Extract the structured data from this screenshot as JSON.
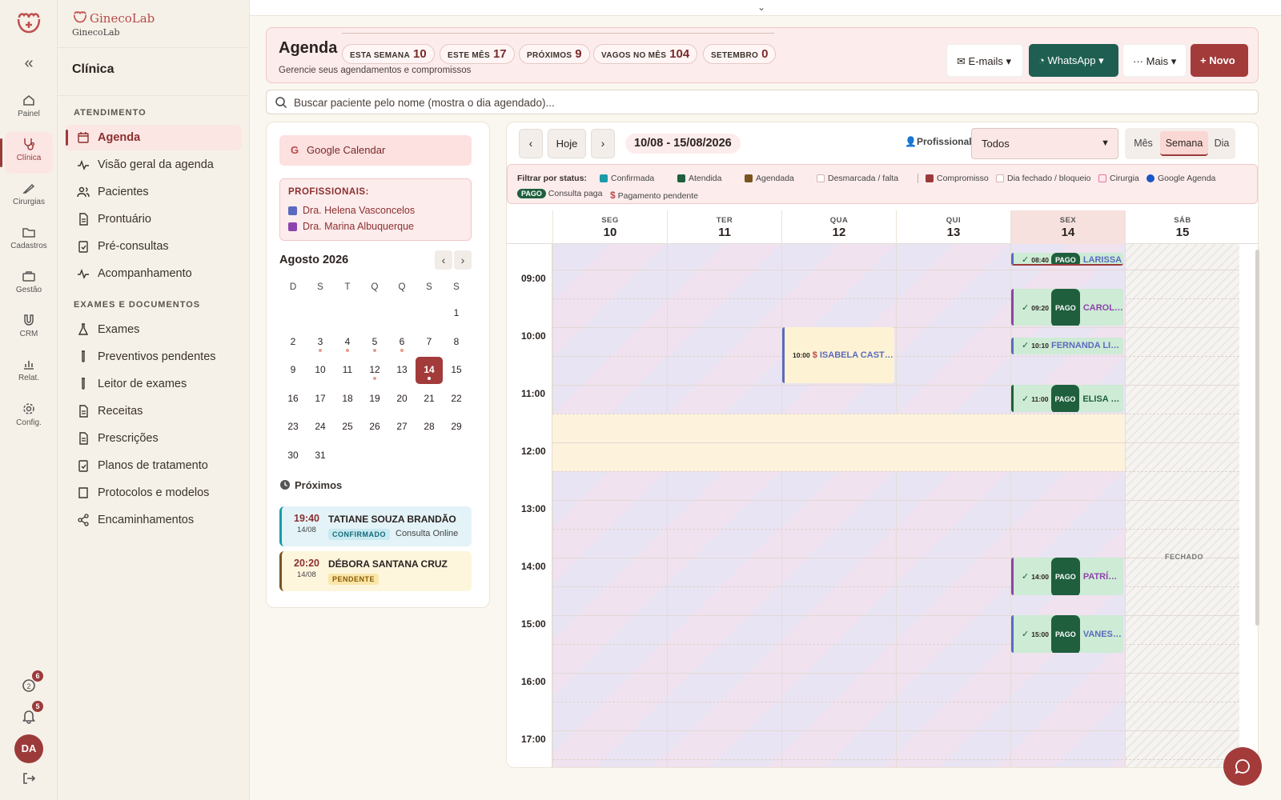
{
  "app": {
    "brand_name": "GinecoLab",
    "brand_sub": "GinecoLab"
  },
  "rail": {
    "items": [
      {
        "label": "Painel",
        "icon": "home-icon"
      },
      {
        "label": "Clínica",
        "icon": "stethoscope-icon",
        "active": true
      },
      {
        "label": "Cirurgias",
        "icon": "scalpel-icon"
      },
      {
        "label": "Cadastros",
        "icon": "folder-icon"
      },
      {
        "label": "Gestão",
        "icon": "briefcase-icon"
      },
      {
        "label": "CRM",
        "icon": "magnet-icon"
      },
      {
        "label": "Relat.",
        "icon": "bar-chart-icon"
      },
      {
        "label": "Config.",
        "icon": "gear-icon"
      }
    ],
    "help_badge": "6",
    "notif_badge": "5",
    "avatar_initials": "DA"
  },
  "sidebar": {
    "title": "Clínica",
    "section1": "ATENDIMENTO",
    "section1_items": [
      "Agenda",
      "Visão geral da agenda",
      "Pacientes",
      "Prontuário",
      "Pré-consultas",
      "Acompanhamento"
    ],
    "section2": "EXAMES E DOCUMENTOS",
    "section2_items": [
      "Exames",
      "Preventivos pendentes",
      "Leitor de exames",
      "Receitas",
      "Prescrições",
      "Planos de tratamento",
      "Protocolos e modelos",
      "Encaminhamentos"
    ]
  },
  "header": {
    "title": "Agenda",
    "subtitle": "Gerencie seus agendamentos e compromissos",
    "stats": [
      {
        "label": "ESTA SEMANA",
        "value": "10"
      },
      {
        "label": "ESTE MÊS",
        "value": "17"
      },
      {
        "label": "PRÓXIMOS",
        "value": "9"
      },
      {
        "label": "VAGOS NO MÊS",
        "value": "104"
      },
      {
        "label": "SETEMBRO",
        "value": "0"
      }
    ],
    "btn_emails": "E-mails",
    "btn_whatsapp": "WhatsApp",
    "btn_more": "Mais",
    "btn_new": "Novo"
  },
  "search": {
    "placeholder": "Buscar paciente pelo nome (mostra o dia agendado)..."
  },
  "left": {
    "google_btn": "Google Calendar",
    "prof_title": "PROFISSIONAIS:",
    "professionals": [
      {
        "name": "Dra. Helena Vasconcelos",
        "color": "#5b6abf"
      },
      {
        "name": "Dra. Marina Albuquerque",
        "color": "#8e44ad"
      }
    ],
    "month_title": "Agosto 2026",
    "weekdays": [
      "D",
      "S",
      "T",
      "Q",
      "Q",
      "S",
      "S"
    ],
    "weeks": [
      [
        "",
        "",
        "",
        "",
        "",
        "",
        "1"
      ],
      [
        "2",
        "3",
        "4",
        "5",
        "6",
        "7",
        "8"
      ],
      [
        "9",
        "10",
        "11",
        "12",
        "13",
        "14",
        "15"
      ],
      [
        "16",
        "17",
        "18",
        "19",
        "20",
        "21",
        "22"
      ],
      [
        "23",
        "24",
        "25",
        "26",
        "27",
        "28",
        "29"
      ],
      [
        "30",
        "31",
        "",
        "",
        "",
        "",
        ""
      ]
    ],
    "today": "14",
    "dot_days": [
      "3",
      "4",
      "5",
      "6",
      "12",
      "14"
    ],
    "next_title": "Próximos",
    "next": [
      {
        "time": "19:40",
        "date": "14/08",
        "name": "TATIANE SOUZA BRANDÃO",
        "badge": "CONFIRMADO",
        "type": "Consulta Online"
      },
      {
        "time": "20:20",
        "date": "14/08",
        "name": "DÉBORA SANTANA CRUZ",
        "badge": "PENDENTE",
        "type": ""
      }
    ]
  },
  "calendar": {
    "btn_today": "Hoje",
    "range": "10/08 - 15/08/2026",
    "prof_label": "Profissional:",
    "prof_value": "Todos",
    "views": [
      "Mês",
      "Semana",
      "Dia"
    ],
    "active_view": "Semana",
    "filter_label": "Filtrar por status:",
    "filters": [
      {
        "label": "Confirmada",
        "color": "#1b9aaa"
      },
      {
        "label": "Atendida",
        "color": "#1f5f3d"
      },
      {
        "label": "Agendada",
        "color": "#7a5420"
      },
      {
        "label": "Desmarcada / falta",
        "color": "#ffffff"
      },
      {
        "label": "Compromisso",
        "color": "#9c3a3a"
      },
      {
        "label": "Dia fechado / bloqueio",
        "color": "#ffffff"
      },
      {
        "label": "Cirurgia",
        "color": "#fde8ef"
      },
      {
        "label": "Google Agenda",
        "color": "#1a56c4"
      }
    ],
    "legend_pago": "PAGO",
    "legend_pago_text": "Consulta paga",
    "legend_dollar": "$",
    "legend_dollar_text": "Pagamento pendente",
    "days": [
      {
        "name": "SEG",
        "num": "10"
      },
      {
        "name": "TER",
        "num": "11"
      },
      {
        "name": "QUA",
        "num": "12"
      },
      {
        "name": "QUI",
        "num": "13"
      },
      {
        "name": "SEX",
        "num": "14"
      },
      {
        "name": "SÁB",
        "num": "15"
      }
    ],
    "hours": [
      "09:00",
      "10:00",
      "11:00",
      "12:00",
      "13:00",
      "14:00",
      "15:00",
      "16:00",
      "17:00"
    ],
    "closed_label": "FECHADO",
    "events": [
      {
        "day": 4,
        "start": 8.7,
        "dur": 0.25,
        "time": "08:40",
        "paid": true,
        "name": "LARISSA",
        "color": "#5b6abf",
        "bg": "#cdebd5"
      },
      {
        "day": 4,
        "start": 9.33,
        "dur": 0.67,
        "time": "09:20",
        "paid": true,
        "name": "CAROLINA",
        "color": "#8e44ad",
        "bg": "#cdebd5"
      },
      {
        "day": 4,
        "start": 10.17,
        "dur": 0.33,
        "time": "10:10",
        "paid": false,
        "name": "FERNANDA LIMA",
        "color": "#5b6abf",
        "bg": "#cdebd5"
      },
      {
        "day": 2,
        "start": 10.0,
        "dur": 1.0,
        "time": "10:00",
        "paid": false,
        "pending": true,
        "name": "ISABELA CASTRO",
        "color": "#5b6abf",
        "bg": "#fdf3d4"
      },
      {
        "day": 4,
        "start": 11.0,
        "dur": 0.5,
        "time": "11:00",
        "paid": true,
        "name": "ELISA MOURA",
        "color": "#1f5f3d",
        "bg": "#cdebd5"
      },
      {
        "day": 4,
        "start": 14.0,
        "dur": 0.67,
        "time": "14:00",
        "paid": true,
        "name": "PATRÍCIA",
        "color": "#8e44ad",
        "bg": "#cdebd5"
      },
      {
        "day": 4,
        "start": 15.0,
        "dur": 0.67,
        "time": "15:00",
        "paid": true,
        "name": "VANESSA",
        "color": "#5b6abf",
        "bg": "#cdebd5"
      }
    ]
  }
}
